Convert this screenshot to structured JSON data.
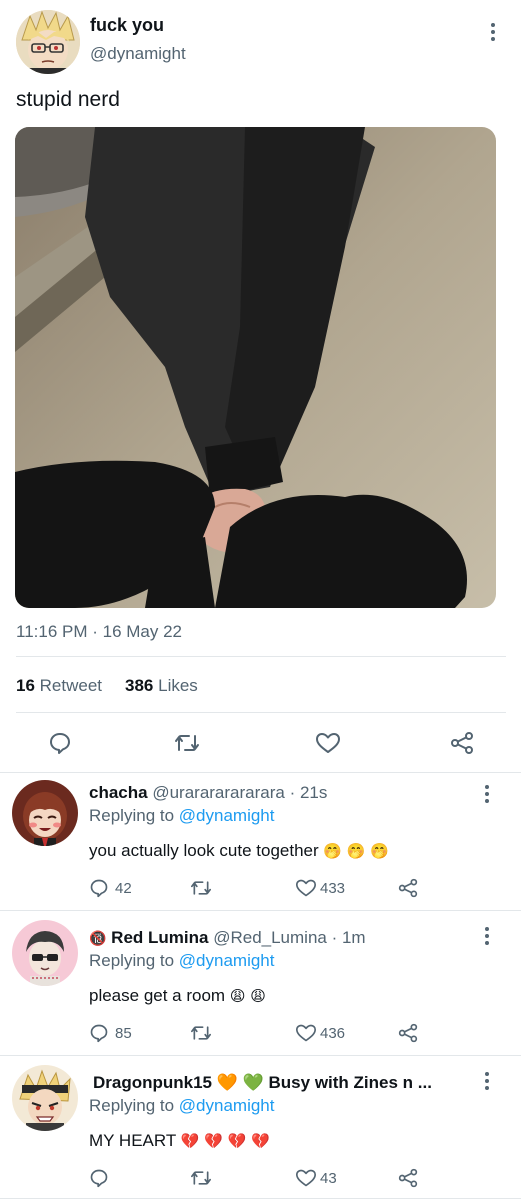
{
  "tweet": {
    "display_name": "fuck you",
    "handle": "@dynamight",
    "text": "stupid nerd",
    "timestamp": "11:16 PM · 16 May 22",
    "retweet_count": "16",
    "retweet_label": "Retweet",
    "like_count": "386",
    "like_label": "Likes"
  },
  "replies": [
    {
      "name": "chacha",
      "handle": "@urarararararara",
      "time": "· 21s",
      "replying_label": "Replying to",
      "replying_to": "@dynamight",
      "text": "you actually look cute together",
      "emojis": "🤭 🤭 🤭",
      "reply_count": "42",
      "like_count": "433"
    },
    {
      "badge": "🔞",
      "name": "Red Lumina",
      "handle": "@Red_Lumina",
      "time": "· 1m",
      "replying_label": "Replying to",
      "replying_to": "@dynamight",
      "text": "please get a room",
      "emojis": "😩 😩",
      "reply_count": "85",
      "like_count": "436"
    },
    {
      "name": "Dragonpunk15 🧡 💚 Busy with Zines n ...",
      "replying_label": "Replying to",
      "replying_to": "@dynamight",
      "text": "MY HEART",
      "emojis": "💔 💔 💔 💔",
      "like_count": "43"
    }
  ],
  "colors": {
    "accent": "#1d9bf0",
    "muted": "#536471",
    "divider": "#e3e7ea"
  }
}
